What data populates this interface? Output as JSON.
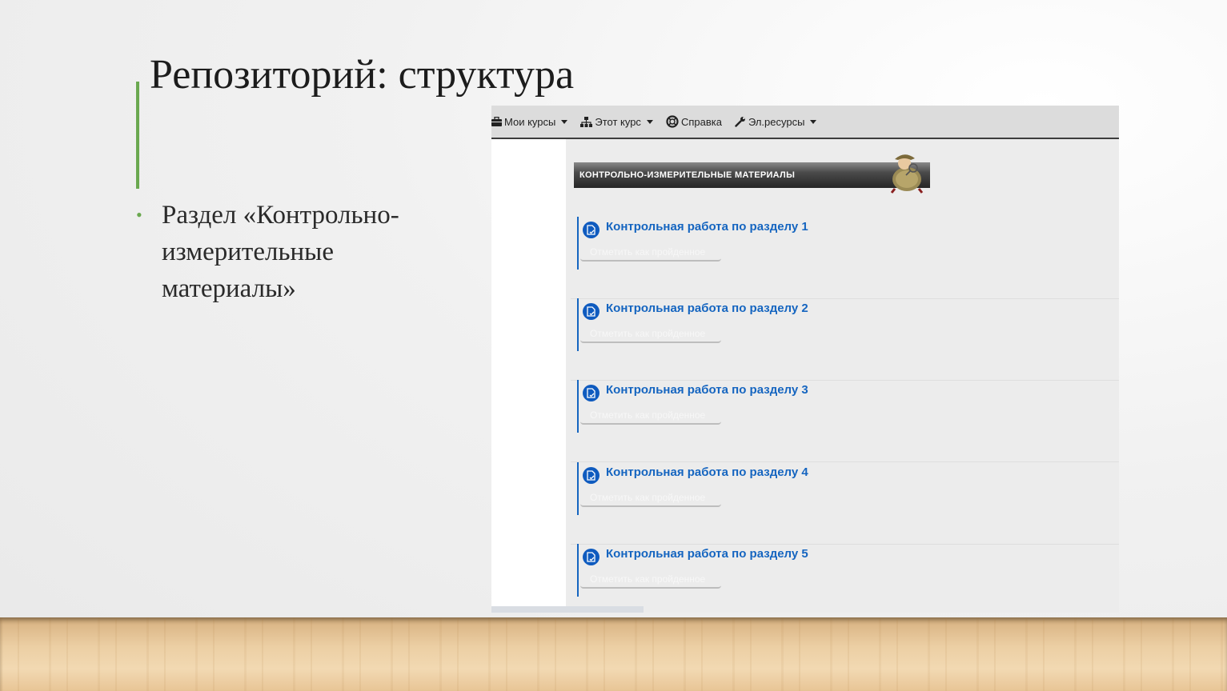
{
  "slide": {
    "title": "Репозиторий: структура",
    "bullet": "Раздел «Контрольно-измерительные материалы»"
  },
  "lms": {
    "nav": [
      {
        "label": "Мои курсы",
        "icon": "briefcase-icon",
        "dropdown": true
      },
      {
        "label": "Этот курс",
        "icon": "sitemap-icon",
        "dropdown": true
      },
      {
        "label": "Справка",
        "icon": "lifebuoy-icon",
        "dropdown": false
      },
      {
        "label": "Эл.ресурсы",
        "icon": "wrench-icon",
        "dropdown": true
      }
    ],
    "section_banner": "КОНТРОЛЬНО-ИЗМЕРИТЕЛЬНЫЕ МАТЕРИАЛЫ",
    "activities": [
      {
        "title": "Контрольная работа по разделу 1",
        "button": "Отметить как пройденное"
      },
      {
        "title": "Контрольная работа по разделу 2",
        "button": "Отметить как пройденное"
      },
      {
        "title": "Контрольная работа по разделу 3",
        "button": "Отметить как пройденное"
      },
      {
        "title": "Контрольная работа по разделу 4",
        "button": "Отметить как пройденное"
      },
      {
        "title": "Контрольная работа по разделу 5",
        "button": "Отметить как пройденное"
      }
    ]
  },
  "colors": {
    "accent": "#6aa84f",
    "link": "#1565c0",
    "icon_bg": "#0f5bbf"
  }
}
